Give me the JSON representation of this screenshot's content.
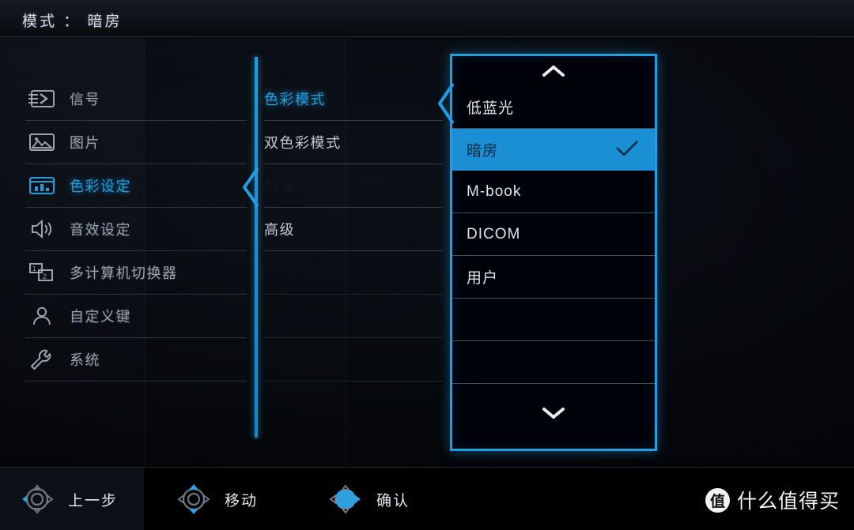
{
  "header": {
    "label": "模式",
    "separator": "：",
    "value": "暗房",
    "full": "模式 ： 暗房"
  },
  "colors": {
    "accent": "#1f9ee0",
    "selected_row": "#1a8fd4",
    "background": "#05070c",
    "text": "#9aa3ae",
    "text_bright": "#dfe4ea"
  },
  "sidebar": {
    "items": [
      {
        "label": "信号",
        "icon": "signal-input-icon",
        "active": false
      },
      {
        "label": "图片",
        "icon": "picture-icon",
        "active": false
      },
      {
        "label": "色彩设定",
        "icon": "color-settings-icon",
        "active": true
      },
      {
        "label": "音效设定",
        "icon": "speaker-icon",
        "active": false
      },
      {
        "label": "多计算机切换器",
        "icon": "kvm-switch-icon",
        "active": false
      },
      {
        "label": "自定义键",
        "icon": "user-icon",
        "active": false
      },
      {
        "label": "系统",
        "icon": "wrench-icon",
        "active": false
      }
    ]
  },
  "submenu": {
    "items": [
      {
        "label": "色彩模式",
        "state": "active"
      },
      {
        "label": "双色彩模式",
        "state": "normal"
      },
      {
        "label": "色温",
        "state": "disabled"
      },
      {
        "label": "高级",
        "state": "normal"
      },
      {
        "label": "",
        "state": "blank"
      },
      {
        "label": "",
        "state": "blank"
      },
      {
        "label": "",
        "state": "blank"
      }
    ]
  },
  "dropdown": {
    "scroll_up_icon": "chevron-up-icon",
    "scroll_down_icon": "chevron-down-icon",
    "check_icon": "check-icon",
    "options": [
      {
        "label": "低蓝光",
        "selected": false
      },
      {
        "label": "暗房",
        "selected": true
      },
      {
        "label": "M-book",
        "selected": false
      },
      {
        "label": "DICOM",
        "selected": false
      },
      {
        "label": "用户",
        "selected": false
      },
      {
        "label": "",
        "selected": false
      },
      {
        "label": "",
        "selected": false
      }
    ]
  },
  "bottom_bar": {
    "hints": [
      {
        "label": "上一步",
        "icon": "dpad-left-icon",
        "direction": "left"
      },
      {
        "label": "移动",
        "icon": "dpad-updown-icon",
        "direction": "up-down"
      },
      {
        "label": "确认",
        "icon": "dpad-center-icon",
        "direction": "center-right"
      }
    ]
  },
  "watermark": {
    "logo": "值",
    "text": "什么值得买"
  }
}
